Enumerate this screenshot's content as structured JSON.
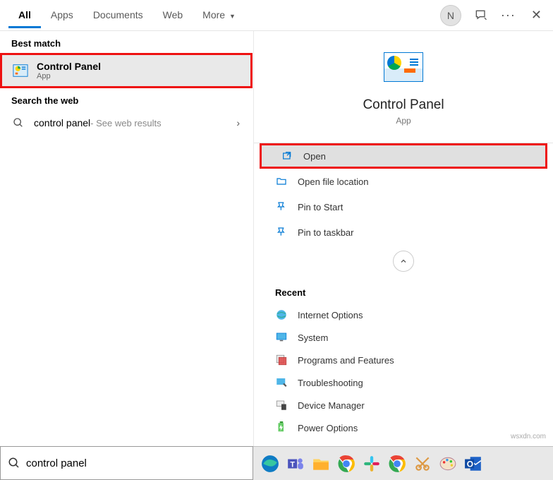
{
  "tabs": [
    "All",
    "Apps",
    "Documents",
    "Web",
    "More"
  ],
  "active_tab": 0,
  "avatar_letter": "N",
  "left": {
    "best_match_header": "Best match",
    "best_match": {
      "title": "Control Panel",
      "sub": "App"
    },
    "web_header": "Search the web",
    "web_prefix": "control panel",
    "web_suffix": " - See web results"
  },
  "preview": {
    "title": "Control Panel",
    "sub": "App"
  },
  "actions": [
    "Open",
    "Open file location",
    "Pin to Start",
    "Pin to taskbar"
  ],
  "recent_header": "Recent",
  "recent": [
    "Internet Options",
    "System",
    "Programs and Features",
    "Troubleshooting",
    "Device Manager",
    "Power Options"
  ],
  "search_value": "control panel",
  "watermark": "wsxdn.com"
}
